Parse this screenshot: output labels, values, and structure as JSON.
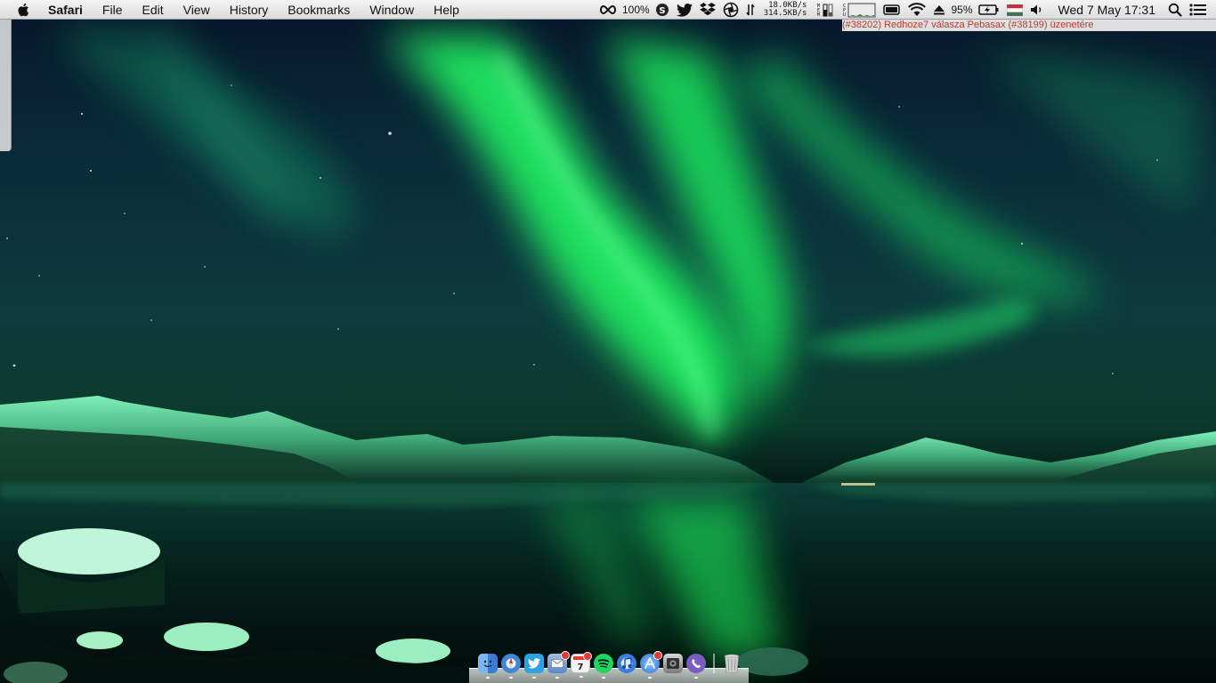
{
  "menubar": {
    "app_name": "Safari",
    "menus": [
      "File",
      "Edit",
      "View",
      "History",
      "Bookmarks",
      "Window",
      "Help"
    ],
    "status": {
      "zoom_percent": "100%",
      "net_down": "18.0KB/s",
      "net_up": "314.5KB/s",
      "battery_percent": "95%",
      "datetime": "Wed 7 May  17:31"
    }
  },
  "background_window": {
    "tab_text": "(#38202) Redhoze7 válasza Pebasax (#38199) üzenetére"
  },
  "dock": {
    "apps": [
      {
        "name": "finder-icon",
        "color": "#4a8fd8"
      },
      {
        "name": "safari-icon",
        "color": "#2f7fd6"
      },
      {
        "name": "twitter-icon",
        "color": "#2aa3e6"
      },
      {
        "name": "mail-icon",
        "color": "#5b87c7",
        "badge": true
      },
      {
        "name": "calendar-icon",
        "color": "#f4f4f4",
        "badge": true
      },
      {
        "name": "spotify-icon",
        "color": "#2a2a2a"
      },
      {
        "name": "itunes-icon",
        "color": "#3b7dde"
      },
      {
        "name": "app-store-icon",
        "color": "#3b8fe0",
        "badge": true
      },
      {
        "name": "photo-booth-icon",
        "color": "#777777"
      },
      {
        "name": "viber-icon",
        "color": "#7b5cc0"
      }
    ],
    "trash": "trash-icon"
  },
  "colors": {
    "aurora": "#1eff5a",
    "sky": "#06162a",
    "water": "#031612"
  }
}
